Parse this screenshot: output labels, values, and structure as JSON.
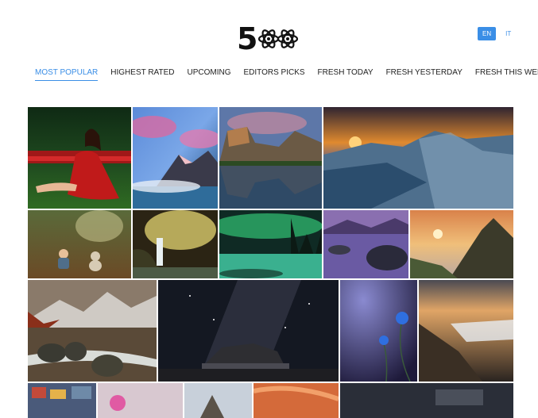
{
  "logo": {
    "digit": "5",
    "icon": "atom-rings-icon"
  },
  "languages": [
    {
      "code": "EN",
      "active": true
    },
    {
      "code": "IT",
      "active": false
    }
  ],
  "nav": [
    {
      "label": "MOST POPULAR",
      "active": true
    },
    {
      "label": "HIGHEST RATED",
      "active": false
    },
    {
      "label": "UPCOMING",
      "active": false
    },
    {
      "label": "EDITORS PICKS",
      "active": false
    },
    {
      "label": "FRESH TODAY",
      "active": false
    },
    {
      "label": "FRESH YESTERDAY",
      "active": false
    },
    {
      "label": "FRESH THIS WEEK",
      "active": false
    }
  ],
  "colors": {
    "accent": "#3a8ee6"
  },
  "photos": [
    {
      "subject": "woman-in-red-dress-tulips"
    },
    {
      "subject": "pink-clouds-mountain-lake"
    },
    {
      "subject": "yosemite-valley-reflection"
    },
    {
      "subject": "ice-sunset"
    },
    {
      "subject": "child-with-teddy-bear"
    },
    {
      "subject": "cave-waterfall"
    },
    {
      "subject": "aurora-over-lake"
    },
    {
      "subject": "purple-lake-islands"
    },
    {
      "subject": "mountain-sunset-valley"
    },
    {
      "subject": "mountain-river-rocks"
    },
    {
      "subject": "milky-way-old-car"
    },
    {
      "subject": "blue-flowers-night"
    },
    {
      "subject": "coastal-rocks-waves"
    },
    {
      "subject": "city-street"
    },
    {
      "subject": "pink-flower"
    },
    {
      "subject": "rocky-peaks"
    },
    {
      "subject": "orange-canyon"
    },
    {
      "subject": "dark-landscape"
    }
  ]
}
